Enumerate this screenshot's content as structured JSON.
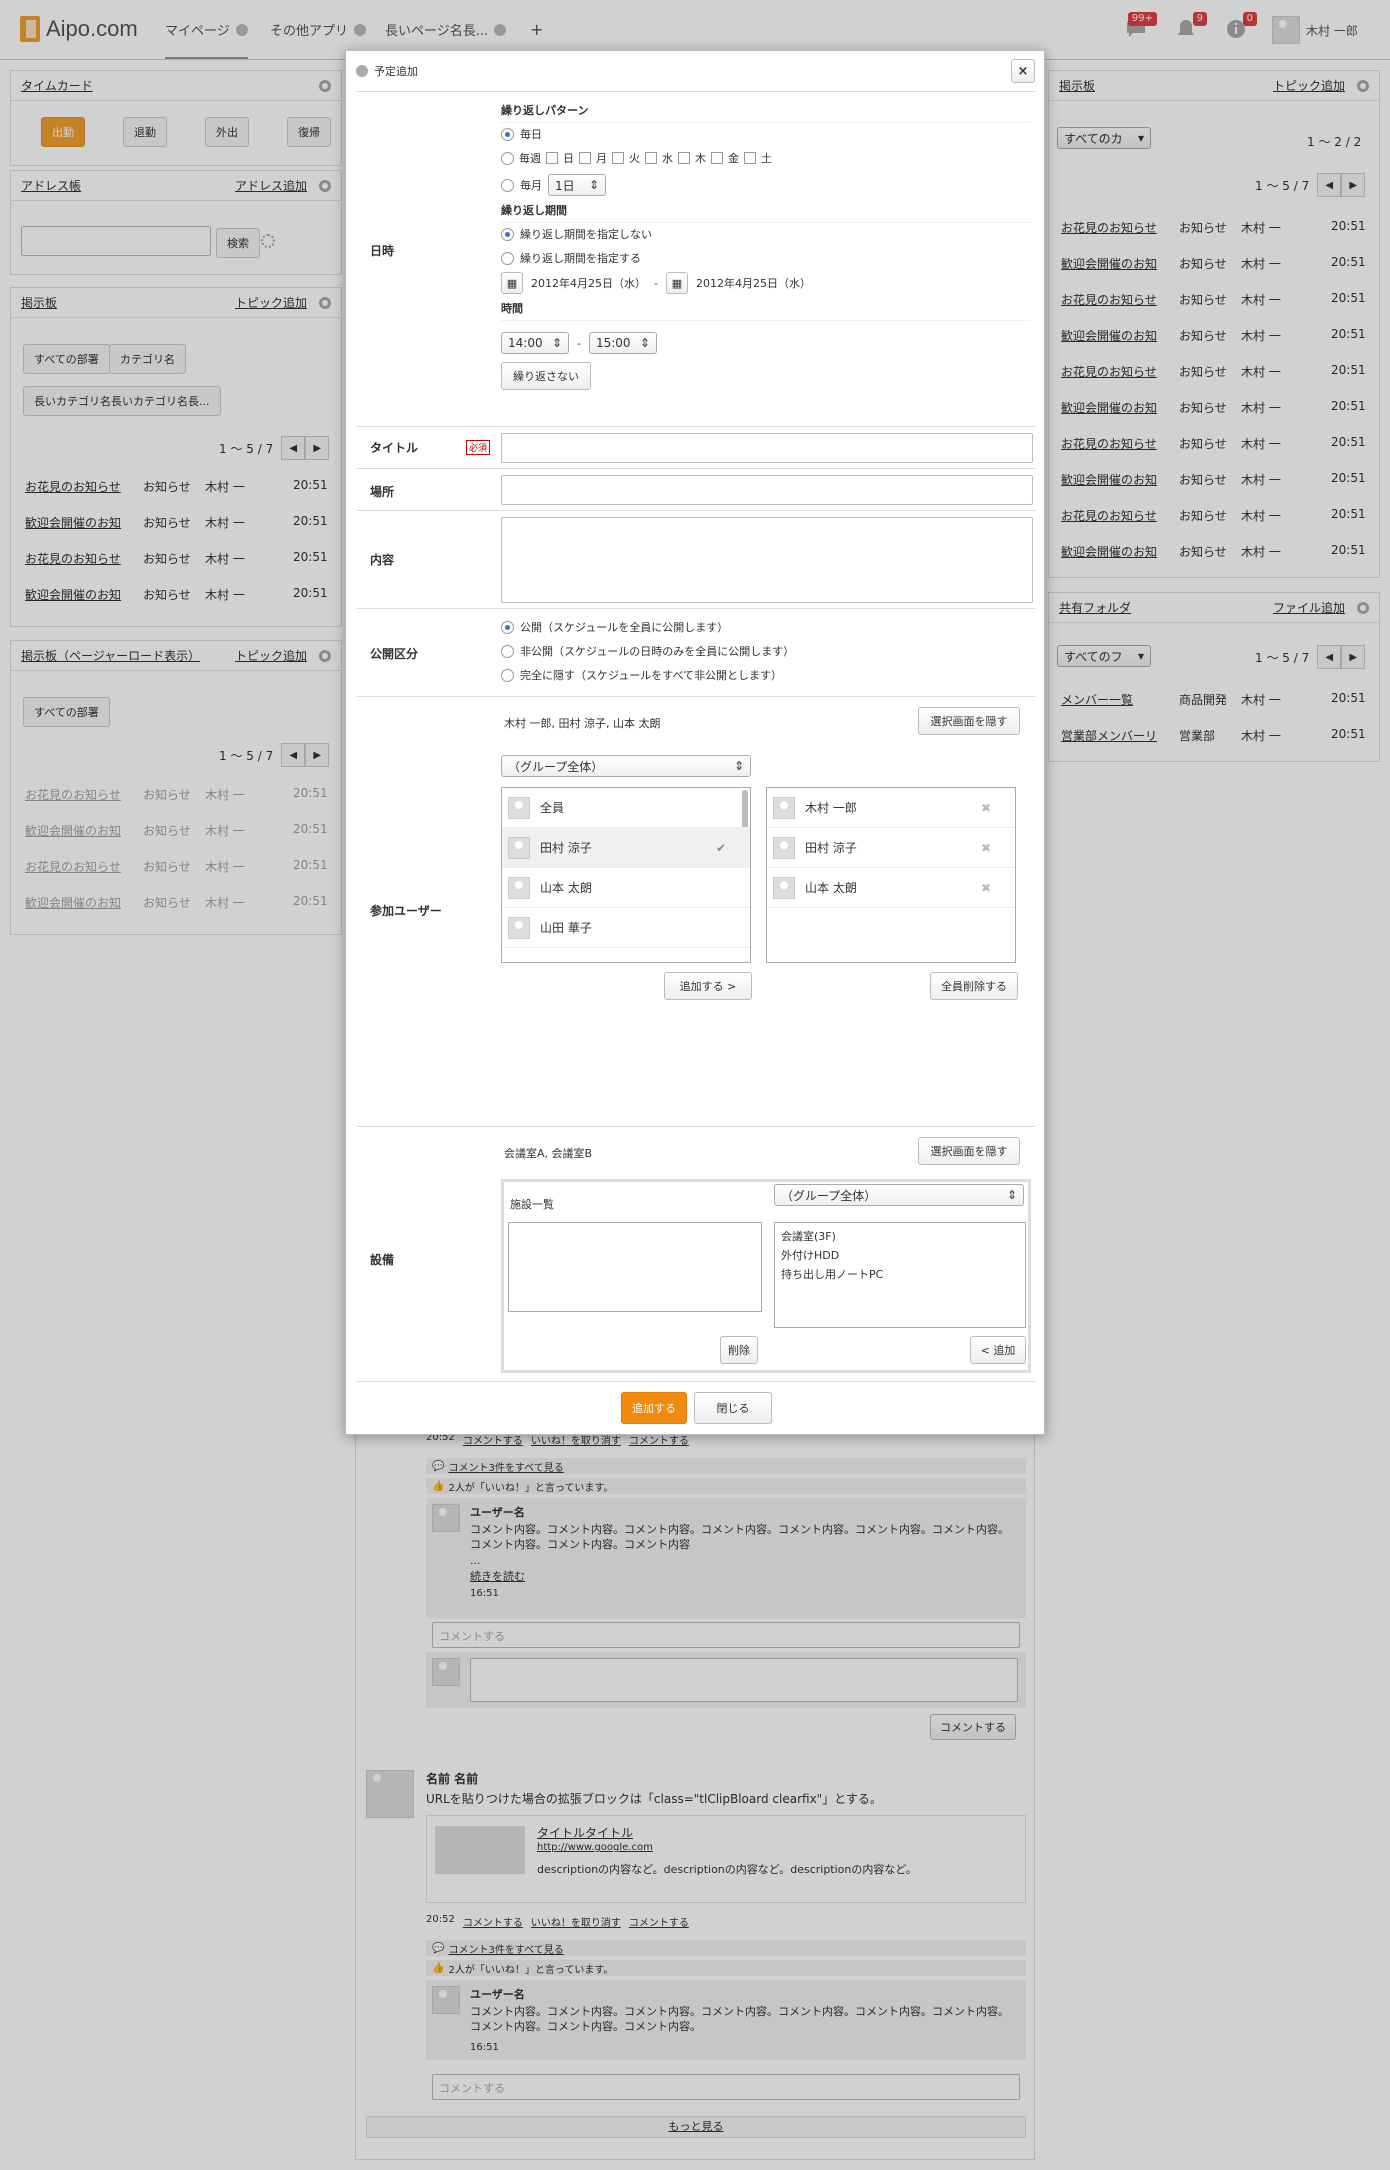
{
  "header": {
    "logo": "Aipo.com",
    "tabs": [
      {
        "label": "マイページ"
      },
      {
        "label": "その他アプリ"
      },
      {
        "label": "長いページ名長..."
      },
      {
        "label": "+"
      }
    ],
    "badges": {
      "messages": "99+",
      "notices": "9",
      "info": "0"
    },
    "user_name": "木村 一郎"
  },
  "left": {
    "timecard": {
      "title": "タイムカード",
      "buttons": [
        "出勤",
        "退勤",
        "外出",
        "復帰"
      ]
    },
    "address": {
      "title": "アドレス帳",
      "add": "アドレス追加",
      "search_btn": "検索"
    },
    "board": {
      "title": "掲示板",
      "add": "トピック追加",
      "tags": [
        "すべての部署",
        "カテゴリ名",
        "長いカテゴリ名長いカテゴリ名長..."
      ],
      "pager": "1 〜 5 / 7",
      "rows": [
        [
          "お花見のお知らせ",
          "お知らせ",
          "木村 一",
          "20:51"
        ],
        [
          "歓迎会開催のお知",
          "お知らせ",
          "木村 一",
          "20:51"
        ],
        [
          "お花見のお知らせ",
          "お知らせ",
          "木村 一",
          "20:51"
        ],
        [
          "歓迎会開催のお知",
          "お知らせ",
          "木村 一",
          "20:51"
        ]
      ]
    },
    "board2": {
      "title": "掲示板（ページャーロード表示）",
      "add": "トピック追加",
      "tag": "すべての部署",
      "pager": "1 〜 5 / 7",
      "rows": [
        [
          "お花見のお知らせ",
          "お知らせ",
          "木村 一",
          "20:51"
        ],
        [
          "歓迎会開催のお知",
          "お知らせ",
          "木村 一",
          "20:51"
        ],
        [
          "お花見のお知らせ",
          "お知らせ",
          "木村 一",
          "20:51"
        ],
        [
          "歓迎会開催のお知",
          "お知らせ",
          "木村 一",
          "20:51"
        ]
      ]
    }
  },
  "right": {
    "board": {
      "title": "掲示板",
      "add": "トピック追加",
      "select": "すべてのカ",
      "count": "1 〜 2 / 2",
      "pager": "1 〜 5 / 7",
      "rows": [
        [
          "お花見のお知らせ",
          "お知らせ",
          "木村 一",
          "20:51"
        ],
        [
          "歓迎会開催のお知",
          "お知らせ",
          "木村 一",
          "20:51"
        ],
        [
          "お花見のお知らせ",
          "お知らせ",
          "木村 一",
          "20:51"
        ],
        [
          "歓迎会開催のお知",
          "お知らせ",
          "木村 一",
          "20:51"
        ],
        [
          "お花見のお知らせ",
          "お知らせ",
          "木村 一",
          "20:51"
        ],
        [
          "歓迎会開催のお知",
          "お知らせ",
          "木村 一",
          "20:51"
        ],
        [
          "お花見のお知らせ",
          "お知らせ",
          "木村 一",
          "20:51"
        ],
        [
          "歓迎会開催のお知",
          "お知らせ",
          "木村 一",
          "20:51"
        ],
        [
          "お花見のお知らせ",
          "お知らせ",
          "木村 一",
          "20:51"
        ],
        [
          "歓迎会開催のお知",
          "お知らせ",
          "木村 一",
          "20:51"
        ]
      ]
    },
    "folder": {
      "title": "共有フォルダ",
      "add": "ファイル追加",
      "select": "すべてのフ",
      "pager": "1 〜 5 / 7",
      "rows": [
        [
          "メンバー一覧",
          "商品開発",
          "木村 一",
          "20:51"
        ],
        [
          "営業部メンバーリ",
          "営業部",
          "木村 一",
          "20:51"
        ]
      ]
    }
  },
  "timeline": {
    "meta1": {
      "time": "20:52",
      "comment": "コメントする",
      "unlike": "いいね！を取り消す",
      "comment2": "コメントする"
    },
    "see_all": "コメント3件をすべて見る",
    "likes": "2人が「いいね！」と言っています。",
    "c1": {
      "user": "ユーザー名",
      "text": "コメント内容。コメント内容。コメント内容。コメント内容。コメント内容。コメント内容。コメント内容。コメント内容。コメント内容。コメント内容",
      "ellipsis": "...",
      "more": "続きを読む",
      "time": "16:51"
    },
    "comment_placeholder": "コメントする",
    "comment_btn": "コメントする",
    "post": {
      "name": "名前 名前",
      "text": "URLを貼りつけた場合の拡張ブロックは「class=\"tlClipBloard clearfix\"」とする。",
      "link_title": "タイトルタイトル",
      "link_url": "http://www.google.com",
      "desc": "descriptionの内容など。descriptionの内容など。descriptionの内容など。"
    },
    "meta2": {
      "time": "20:52",
      "comment": "コメントする",
      "unlike": "いいね！を取り消す",
      "comment2": "コメントする"
    },
    "c2": {
      "user": "ユーザー名",
      "text": "コメント内容。コメント内容。コメント内容。コメント内容。コメント内容。コメント内容。コメント内容。コメント内容。コメント内容。コメント内容。",
      "time": "16:51"
    },
    "more": "もっと見る"
  },
  "modal": {
    "title": "予定追加",
    "close": "×",
    "date_label": "日時",
    "repeat_pattern": "繰り返しパターン",
    "daily": "毎日",
    "weekly": "毎週",
    "days": [
      "日",
      "月",
      "火",
      "水",
      "木",
      "金",
      "土"
    ],
    "monthly": "毎月",
    "monthly_day": "1日",
    "repeat_period": "繰り返し期間",
    "no_period": "繰り返し期間を指定しない",
    "with_period": "繰り返し期間を指定する",
    "date_from": "2012年4月25日（水）",
    "date_sep": "-",
    "date_to": "2012年4月25日（水）",
    "time_label": "時間",
    "time_from": "14:00",
    "time_to": "15:00",
    "no_repeat_btn": "繰り返さない",
    "title_label": "タイトル",
    "required": "必須",
    "place_label": "場所",
    "content_label": "内容",
    "public_label": "公開区分",
    "public_opts": [
      "公開（スケジュールを全員に公開します）",
      "非公開（スケジュールの日時のみを全員に公開します）",
      "完全に隠す（スケジュールをすべて非公開とします）"
    ],
    "users_label": "参加ユーザー",
    "selected_users": "木村 一郎, 田村 涼子, 山本 太朗",
    "hide_btn": "選択画面を隠す",
    "group": "（グループ全体）",
    "left_users": [
      "全員",
      "田村 涼子",
      "山本 太朗",
      "山田 華子"
    ],
    "right_users": [
      "木村 一郎",
      "田村 涼子",
      "山本 太朗"
    ],
    "add_btn": "追加する >",
    "remove_all_btn": "全員削除する",
    "facility_label": "設備",
    "selected_facilities": "会議室A, 会議室B",
    "facility_hide_btn": "選択画面を隠す",
    "facility_list": "施設一覧",
    "facility_group": "（グループ全体）",
    "facilities": [
      "会議室(3F)",
      "外付けHDD",
      "持ち出し用ノートPC"
    ],
    "delete_btn": "削除",
    "fac_add_btn": "< 追加",
    "submit": "追加する",
    "close_btn": "閉じる"
  }
}
